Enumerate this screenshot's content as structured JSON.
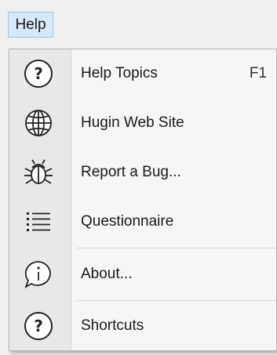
{
  "menubar": {
    "help_label": "Help"
  },
  "menu": {
    "items": [
      {
        "label": "Help Topics",
        "shortcut": "F1",
        "icon": "question-circle-icon"
      },
      {
        "label": "Hugin Web Site",
        "shortcut": "",
        "icon": "globe-icon"
      },
      {
        "label": "Report a Bug...",
        "shortcut": "",
        "icon": "bug-icon"
      },
      {
        "label": "Questionnaire",
        "shortcut": "",
        "icon": "list-icon"
      },
      {
        "label": "About...",
        "shortcut": "",
        "icon": "info-speech-bubble-icon"
      },
      {
        "label": "Shortcuts",
        "shortcut": "",
        "icon": "question-circle-icon"
      }
    ]
  },
  "colors": {
    "menubar_highlight": "#d7e8f6",
    "menubar_highlight_border": "#9cc7e8",
    "menu_background": "#f6f6f6",
    "icon_gutter": "#e8e8e8",
    "separator": "#d4d4d4"
  }
}
